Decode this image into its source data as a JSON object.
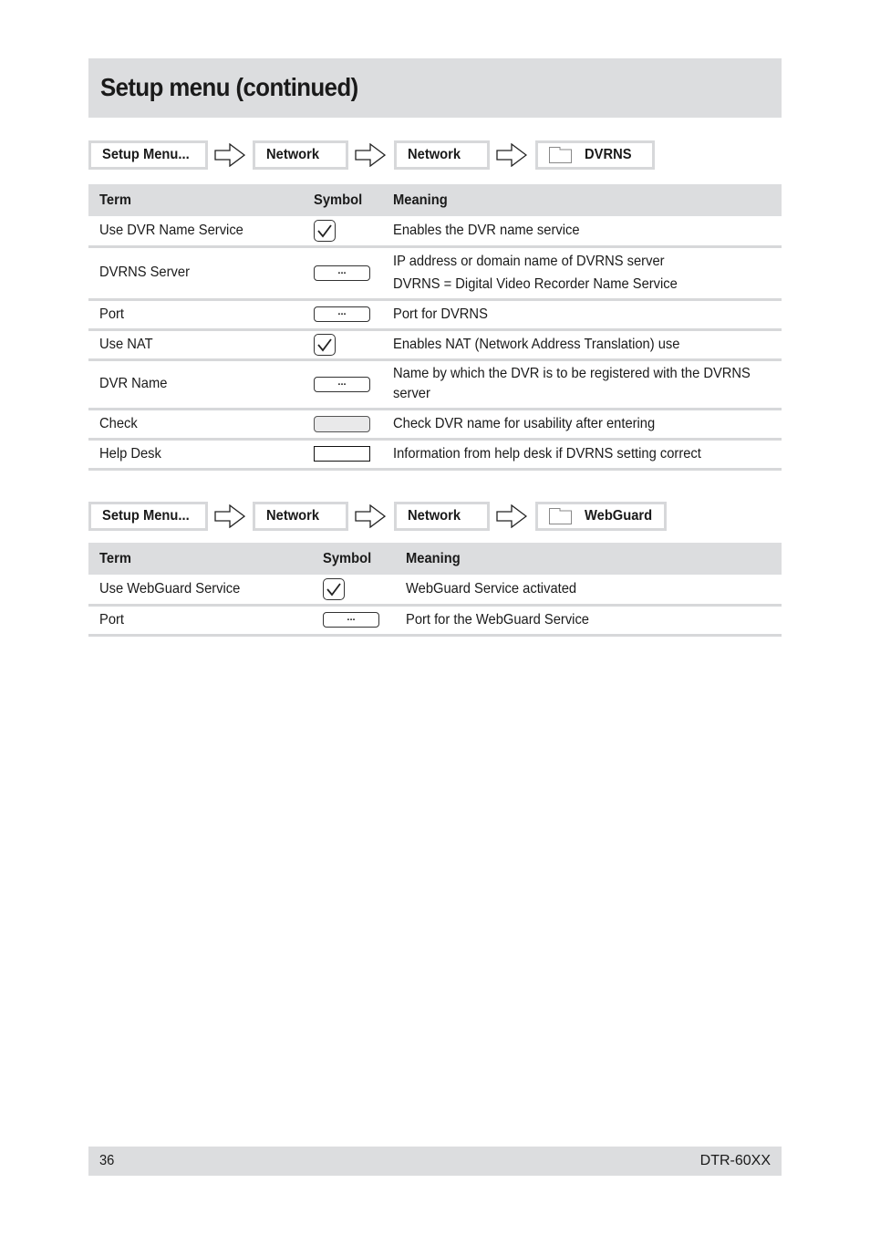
{
  "page_title": "Setup menu (continued)",
  "dvrns_section": {
    "breadcrumb": [
      "Setup Menu...",
      "Network",
      "Network",
      "DVRNS"
    ],
    "headers": {
      "term": "Term",
      "symbol": "Symbol",
      "meaning": "Meaning"
    },
    "rows": [
      {
        "term": "Use DVR Name Service",
        "symbol": "checkbox-checked",
        "meaning": [
          "Enables the DVR name service"
        ]
      },
      {
        "term": "DVRNS Server",
        "symbol": "input-field",
        "meaning": [
          "IP address or domain name of DVRNS server",
          "DVRNS = Digital Video Recorder Name Service"
        ]
      },
      {
        "term": "Port",
        "symbol": "input-field",
        "meaning": [
          "Port for DVRNS"
        ]
      },
      {
        "term": "Use NAT",
        "symbol": "checkbox-checked",
        "meaning": [
          "Enables NAT (Network Address Translation) use"
        ]
      },
      {
        "term": "DVR Name",
        "symbol": "input-field",
        "meaning": [
          "Name by which the DVR is to be registered with the DVRNS",
          "server"
        ]
      },
      {
        "term": "Check",
        "symbol": "button",
        "meaning": [
          "Check DVR name for usability after entering"
        ]
      },
      {
        "term": "Help Desk",
        "symbol": "text-box",
        "meaning": [
          "Information from help desk if DVRNS setting correct"
        ]
      }
    ]
  },
  "webguard_section": {
    "breadcrumb": [
      "Setup Menu...",
      "Network",
      "Network",
      "WebGuard"
    ],
    "headers": {
      "term": "Term",
      "symbol": "Symbol",
      "meaning": "Meaning"
    },
    "rows": [
      {
        "term": "Use WebGuard Service",
        "symbol": "checkbox-checked",
        "meaning": [
          "WebGuard Service activated"
        ]
      },
      {
        "term": "Port",
        "symbol": "input-field",
        "meaning": [
          "Port for the WebGuard Service"
        ]
      }
    ]
  },
  "field_ellipsis": "...",
  "footer": {
    "page_number": "36",
    "model": "DTR-60XX"
  }
}
